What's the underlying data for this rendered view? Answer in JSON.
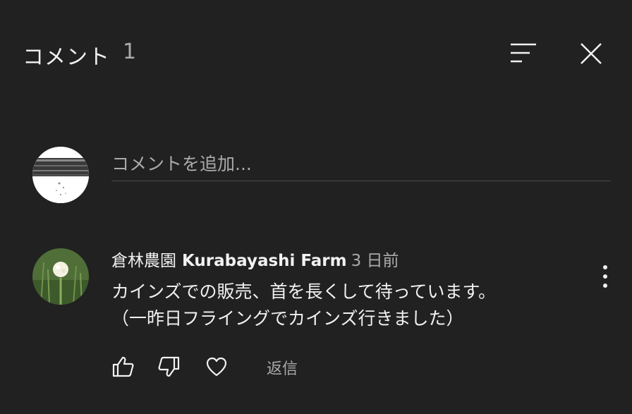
{
  "panel": {
    "title": "コメント",
    "count": "1",
    "sort_icon": "sort-icon",
    "close_icon": "close-icon"
  },
  "add_comment": {
    "placeholder": "コメントを追加..."
  },
  "comments": [
    {
      "author_jp": "倉林農園",
      "author_en": "Kurabayashi Farm",
      "time": "3 日前",
      "lines": [
        "カインズでの販売、首を長くして待っています。",
        "（一昨日フライングでカインズ行きました）"
      ],
      "actions": {
        "like_icon": "thumbs-up-icon",
        "dislike_icon": "thumbs-down-icon",
        "heart_icon": "heart-icon",
        "reply_label": "返信"
      },
      "menu_icon": "more-vertical-icon"
    }
  ],
  "colors": {
    "background": "#212121",
    "text_primary": "#f1f1f1",
    "text_secondary": "#aaaaaa",
    "divider": "#4a4a4a"
  }
}
